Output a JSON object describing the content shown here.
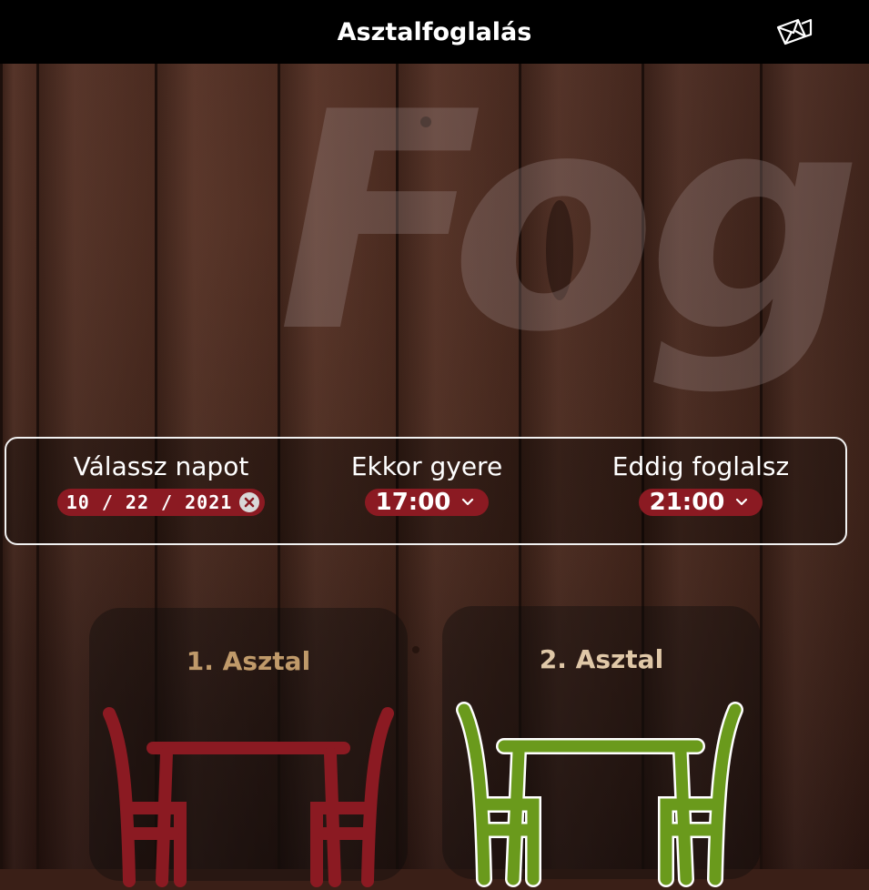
{
  "header": {
    "title": "Asztalfoglalás",
    "mail_icon": "mail-icon"
  },
  "background": {
    "watermark": "Fog"
  },
  "booking": {
    "date_label": "Válassz napot",
    "date_value": "10 / 22 / 2021",
    "from_label": "Ekkor gyere",
    "from_value": "17:00",
    "until_label": "Eddig foglalsz",
    "until_value": "21:00"
  },
  "tables": [
    {
      "label": "1. Asztal",
      "color": "#8b1a22",
      "selected": false
    },
    {
      "label": "2. Asztal",
      "color": "#6a9a1c",
      "selected": true
    }
  ],
  "colors": {
    "accent": "#8b1a22",
    "selected": "#6a9a1c",
    "header_bg": "#000000"
  }
}
